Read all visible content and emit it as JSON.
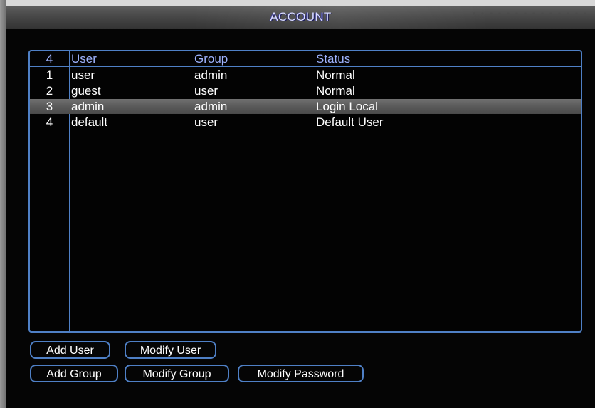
{
  "window": {
    "title": "ACCOUNT"
  },
  "table": {
    "headers": {
      "num": "4",
      "user": "User",
      "group": "Group",
      "status": "Status"
    },
    "rows": [
      {
        "num": "1",
        "user": "user",
        "group": "admin",
        "status": "Normal",
        "selected": false
      },
      {
        "num": "2",
        "user": "guest",
        "group": "user",
        "status": "Normal",
        "selected": false
      },
      {
        "num": "3",
        "user": "admin",
        "group": "admin",
        "status": "Login Local",
        "selected": true
      },
      {
        "num": "4",
        "user": "default",
        "group": "user",
        "status": "Default User",
        "selected": false
      }
    ]
  },
  "buttons": {
    "add_user": "Add User",
    "modify_user": "Modify User",
    "add_group": "Add Group",
    "modify_group": "Modify Group",
    "modify_password": "Modify Password"
  },
  "colors": {
    "accent_border": "#4f80c6",
    "header_text": "#9fb4ff",
    "title_text": "#d9dcff",
    "selected_row": "#5a5a5a"
  }
}
